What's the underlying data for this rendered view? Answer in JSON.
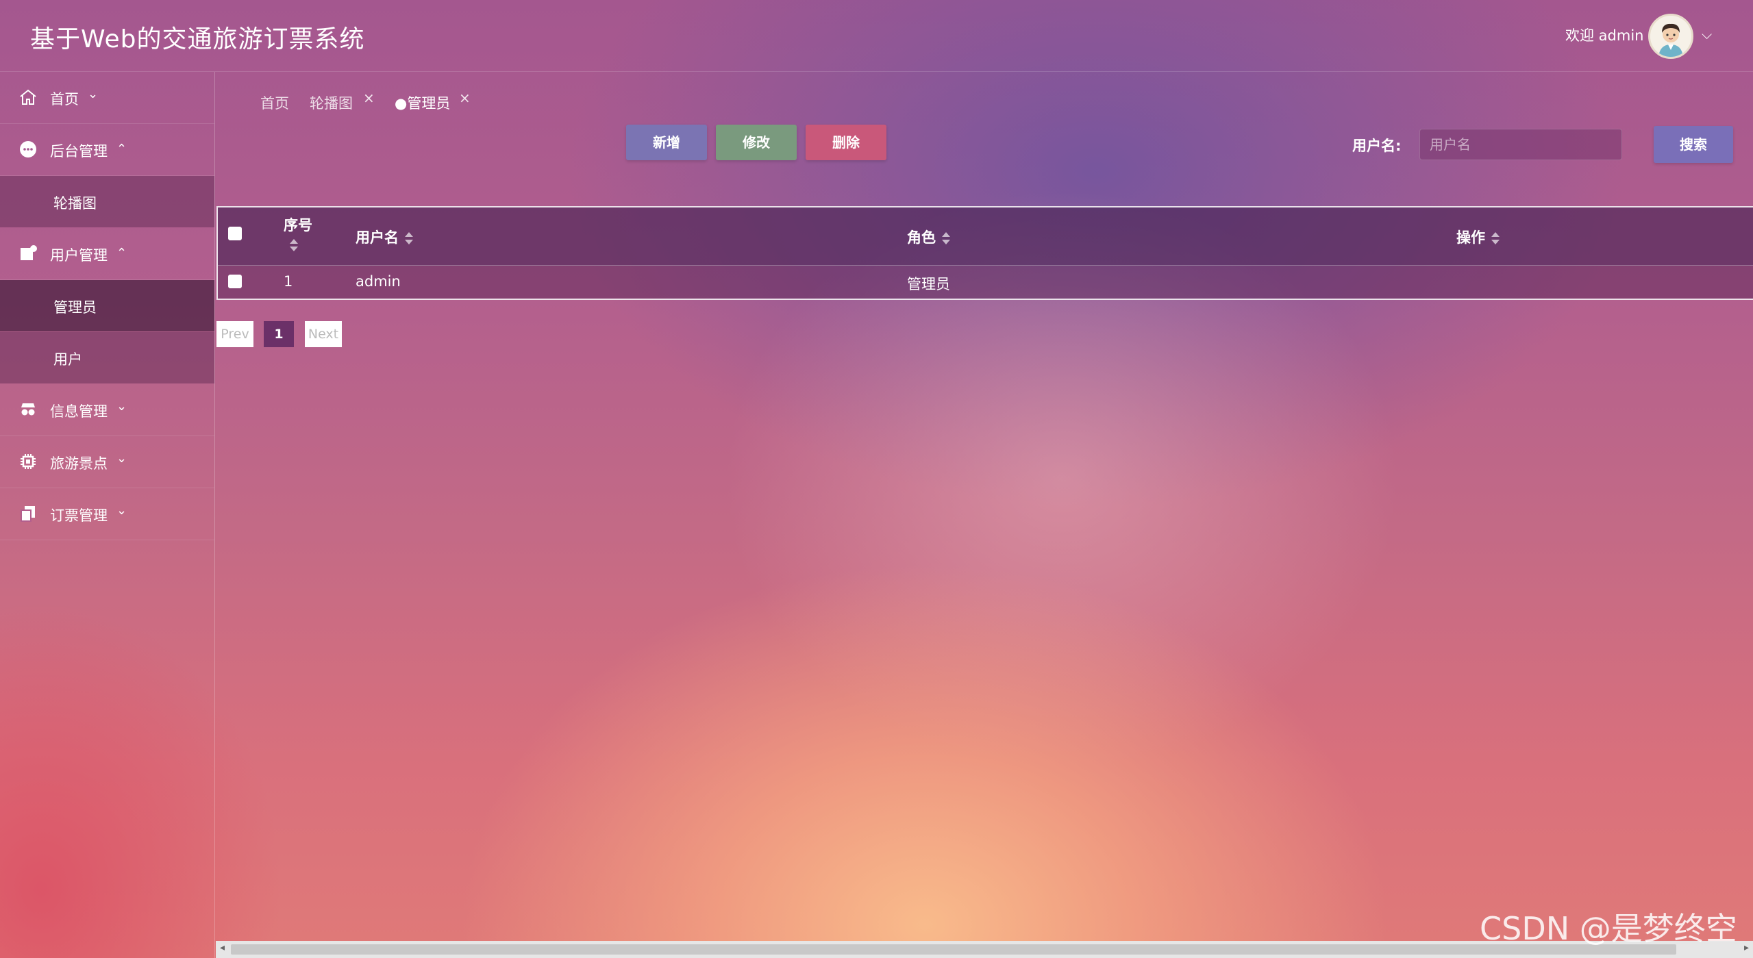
{
  "app": {
    "title": "基于Web的交通旅游订票系统"
  },
  "user": {
    "welcome": "欢迎 admin"
  },
  "sidebar": {
    "items": [
      {
        "label": "首页",
        "icon": "home-icon",
        "expanded": false
      },
      {
        "label": "后台管理",
        "icon": "more-circle-icon",
        "expanded": true,
        "children": [
          "轮播图"
        ]
      },
      {
        "label": "用户管理",
        "icon": "user-card-icon",
        "expanded": true,
        "children": [
          "管理员",
          "用户"
        ]
      },
      {
        "label": "信息管理",
        "icon": "glasses-icon",
        "expanded": false
      },
      {
        "label": "旅游景点",
        "icon": "chip-icon",
        "expanded": false
      },
      {
        "label": "订票管理",
        "icon": "copy-icon",
        "expanded": false
      }
    ],
    "active_child": "管理员"
  },
  "tabs": [
    {
      "label": "首页",
      "closable": false
    },
    {
      "label": "轮播图",
      "closable": true
    },
    {
      "label": "管理员",
      "closable": true,
      "active": true
    }
  ],
  "toolbar": {
    "add_label": "新增",
    "edit_label": "修改",
    "delete_label": "删除",
    "add_color": "#7b74b3",
    "edit_color": "#7a9a7e",
    "delete_color": "#c9587a"
  },
  "search": {
    "label": "用户名:",
    "placeholder": "用户名",
    "button_label": "搜索"
  },
  "table": {
    "columns": [
      "序号",
      "用户名",
      "角色",
      "操作"
    ],
    "rows": [
      {
        "index": "1",
        "username": "admin",
        "role": "管理员",
        "actions": ""
      }
    ]
  },
  "pagination": {
    "prev": "Prev",
    "current": "1",
    "next": "Next"
  },
  "watermark": "CSDN @是梦终空"
}
